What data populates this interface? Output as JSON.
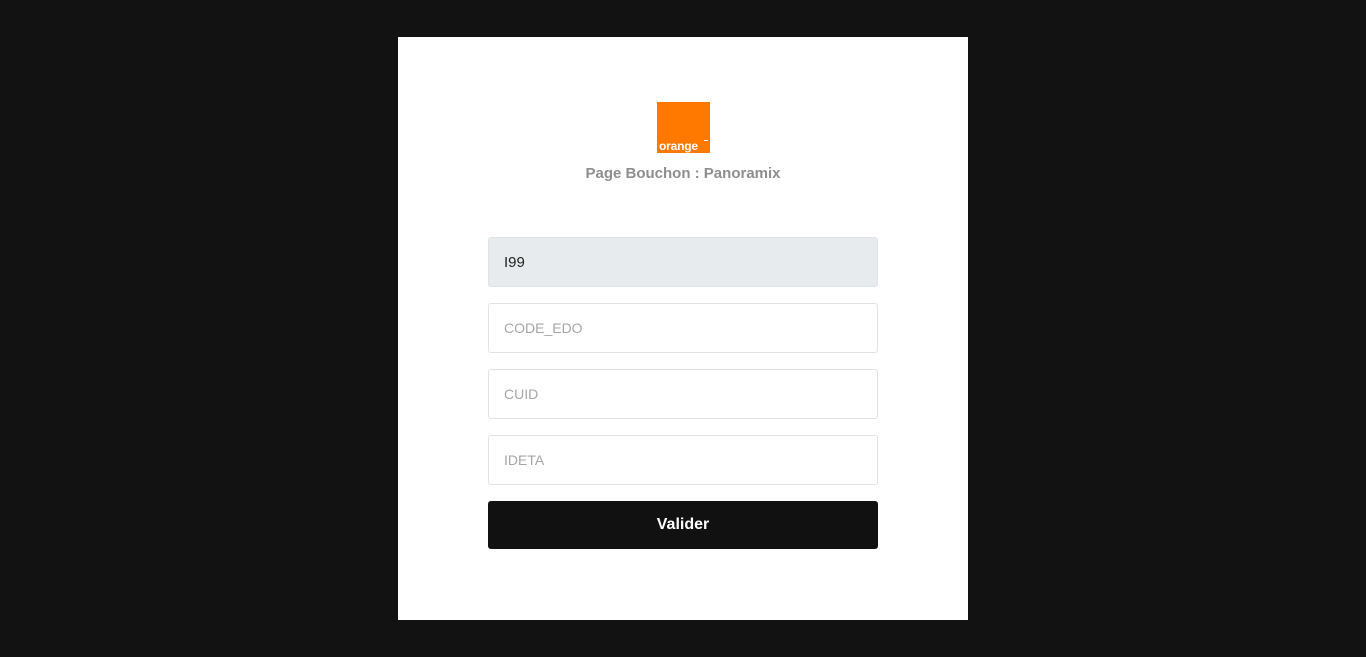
{
  "brand": {
    "logo_text": "orange",
    "logo_color": "#ff7900"
  },
  "page": {
    "title": "Page Bouchon : Panoramix"
  },
  "form": {
    "field_1_value": "I99",
    "code_edo_placeholder": "CODE_EDO",
    "cuid_placeholder": "CUID",
    "ideta_placeholder": "IDETA",
    "submit_label": "Valider"
  },
  "colors": {
    "background": "#121212",
    "card": "#ffffff",
    "filled_input_bg": "#e8ebee",
    "button_bg": "#111111"
  }
}
